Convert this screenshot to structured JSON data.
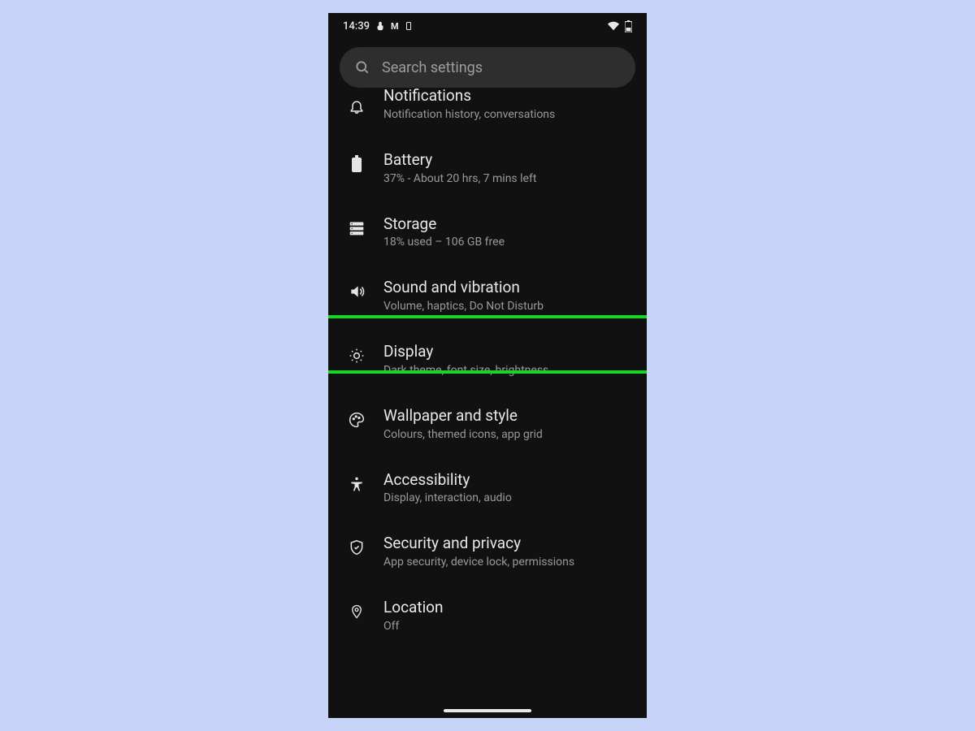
{
  "statusbar": {
    "time": "14:39"
  },
  "search": {
    "placeholder": "Search settings"
  },
  "items": [
    {
      "id": "notifications",
      "title": "Notifications",
      "sub": "Notification history, conversations",
      "cutTop": true
    },
    {
      "id": "battery",
      "title": "Battery",
      "sub": "37% - About 20 hrs, 7 mins left"
    },
    {
      "id": "storage",
      "title": "Storage",
      "sub": "18% used – 106 GB free"
    },
    {
      "id": "sound",
      "title": "Sound and vibration",
      "sub": "Volume, haptics, Do Not Disturb",
      "highlighted": true
    },
    {
      "id": "display",
      "title": "Display",
      "sub": "Dark theme, font size, brightness"
    },
    {
      "id": "wallpaper",
      "title": "Wallpaper and style",
      "sub": "Colours, themed icons, app grid"
    },
    {
      "id": "accessibility",
      "title": "Accessibility",
      "sub": "Display, interaction, audio"
    },
    {
      "id": "security",
      "title": "Security and privacy",
      "sub": "App security, device lock, permissions"
    },
    {
      "id": "location",
      "title": "Location",
      "sub": "Off"
    }
  ],
  "highlight_color": "#14d62a"
}
